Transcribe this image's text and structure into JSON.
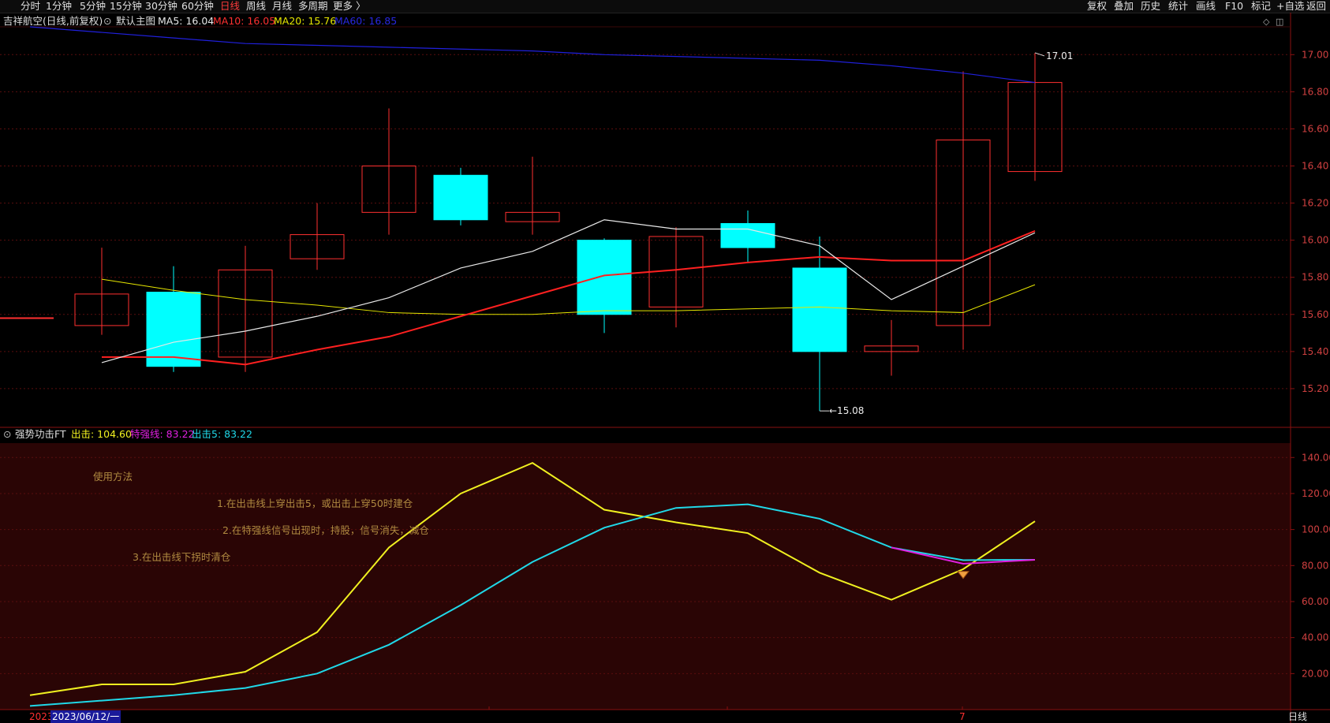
{
  "toolbar": {
    "left": [
      "分时",
      "1分钟",
      "5分钟",
      "15分钟",
      "30分钟",
      "60分钟",
      "日线",
      "周线",
      "月线",
      "多周期",
      "更多 〉"
    ],
    "active": "日线",
    "right": [
      "复权",
      "叠加",
      "历史",
      "统计",
      "画线",
      "F10",
      "标记",
      "+自选",
      "返回"
    ]
  },
  "main_header": {
    "title": "吉祥航空(日线,前复权)",
    "template": "默认主图",
    "ma5": "MA5: 16.04",
    "ma10": "MA10: 16.05",
    "ma20": "MA20: 15.76",
    "ma60": "MA60: 16.85"
  },
  "sub_header": {
    "title": "强势功击FT",
    "chuji": "出击: 104.60",
    "teqiang": "特强线: 83.22",
    "chuji5": "出击5: 83.22"
  },
  "notes": {
    "heading": "使用方法",
    "line1": "1.在出击线上穿出击5，或出击上穿50时建仓",
    "line2": "2.在特强线信号出现时，持股，信号消失，减仓",
    "line3": "3.在出击线下拐时清仓"
  },
  "bottom_bar": {
    "year": "2023",
    "date": "2023/06/12/一",
    "marker": "7",
    "period": "日线"
  },
  "colors": {
    "up": "#ff3030",
    "down": "#00ffff",
    "ma5": "#e8e8e8",
    "ma10": "#ff2020",
    "ma20": "#e6e600",
    "ma60": "#2020dd",
    "chuji": "#f0f020",
    "teqiang": "#e020e0",
    "chuji5": "#20d8e8"
  },
  "chart_data": [
    {
      "type": "candlestick",
      "title": "吉祥航空(日线,前复权)",
      "yticks": [
        "15.20",
        "15.40",
        "15.60",
        "15.80",
        "16.00",
        "16.20",
        "16.40",
        "16.60",
        "16.80",
        "17.00"
      ],
      "ylim": [
        15.0,
        17.15
      ],
      "candles": [
        {
          "open": 15.58,
          "close": 15.58,
          "high": 15.58,
          "low": 15.58
        },
        {
          "open": 15.54,
          "close": 15.71,
          "high": 15.96,
          "low": 15.49
        },
        {
          "open": 15.72,
          "close": 15.32,
          "high": 15.86,
          "low": 15.29
        },
        {
          "open": 15.37,
          "close": 15.84,
          "high": 15.97,
          "low": 15.29
        },
        {
          "open": 15.9,
          "close": 16.03,
          "high": 16.2,
          "low": 15.84
        },
        {
          "open": 16.15,
          "close": 16.4,
          "high": 16.71,
          "low": 16.03
        },
        {
          "open": 16.35,
          "close": 16.11,
          "high": 16.39,
          "low": 16.08
        },
        {
          "open": 16.1,
          "close": 16.15,
          "high": 16.45,
          "low": 16.03
        },
        {
          "open": 16.0,
          "close": 15.6,
          "high": 16.01,
          "low": 15.5
        },
        {
          "open": 15.64,
          "close": 16.02,
          "high": 16.07,
          "low": 15.53
        },
        {
          "open": 16.09,
          "close": 15.96,
          "high": 16.16,
          "low": 15.88
        },
        {
          "open": 15.85,
          "close": 15.4,
          "high": 16.02,
          "low": 15.08
        },
        {
          "open": 15.4,
          "close": 15.43,
          "high": 15.57,
          "low": 15.27
        },
        {
          "open": 15.54,
          "close": 16.54,
          "high": 16.91,
          "low": 15.41
        },
        {
          "open": 16.37,
          "close": 16.85,
          "high": 17.01,
          "low": 16.32
        }
      ],
      "ma5": [
        null,
        15.34,
        15.45,
        15.51,
        15.59,
        15.69,
        15.85,
        15.94,
        16.11,
        16.06,
        16.06,
        15.97,
        15.68,
        15.86,
        16.04
      ],
      "ma10": [
        null,
        15.37,
        15.37,
        15.33,
        15.41,
        15.48,
        15.59,
        15.7,
        15.81,
        15.84,
        15.88,
        15.91,
        15.89,
        15.89,
        16.05
      ],
      "ma20": [
        null,
        15.79,
        15.73,
        15.68,
        15.65,
        15.61,
        15.6,
        15.6,
        15.62,
        15.62,
        15.63,
        15.64,
        15.62,
        15.61,
        15.76
      ],
      "ma60": [
        17.15,
        17.12,
        17.09,
        17.06,
        17.05,
        17.04,
        17.03,
        17.02,
        17.0,
        16.99,
        16.98,
        16.97,
        16.94,
        16.9,
        16.85
      ],
      "annotations": {
        "high": "17.01",
        "low": "15.08"
      }
    },
    {
      "type": "line",
      "title": "强势功击FT",
      "yticks": [
        "20.00",
        "40.00",
        "60.00",
        "80.00",
        "100.00",
        "120.00",
        "140.00"
      ],
      "ylim": [
        0,
        148
      ],
      "series": [
        {
          "name": "出击",
          "values": [
            8,
            14,
            14,
            21,
            43,
            90,
            120,
            137,
            111,
            104,
            98,
            76,
            61,
            78,
            104.6
          ]
        },
        {
          "name": "出击5",
          "values": [
            2,
            5,
            8,
            12,
            20,
            36,
            58,
            82,
            101,
            112,
            114,
            106,
            90,
            83,
            83.22
          ]
        },
        {
          "name": "特强线",
          "values": [
            null,
            null,
            null,
            null,
            null,
            null,
            null,
            null,
            null,
            null,
            null,
            null,
            90,
            81,
            83.22
          ]
        }
      ]
    }
  ]
}
